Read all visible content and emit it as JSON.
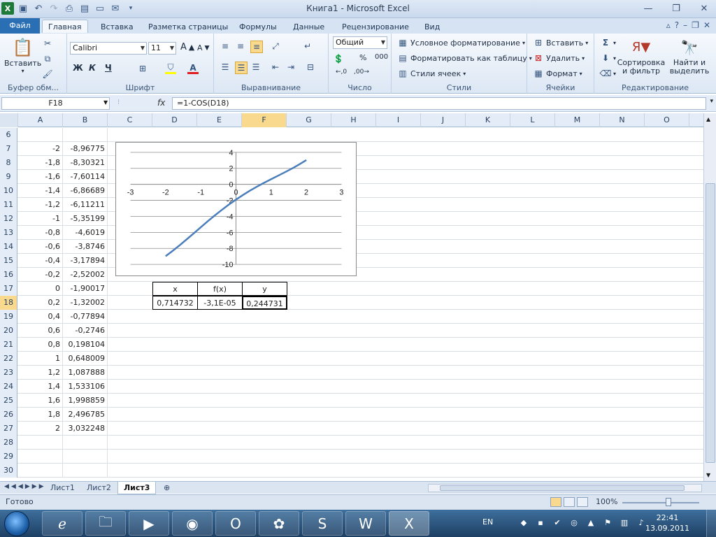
{
  "window": {
    "title": "Книга1  -  Microsoft Excel",
    "qat_icons": [
      "excel-logo-icon",
      "save-icon",
      "undo-icon",
      "redo-icon",
      "print-preview-icon",
      "quick-print-icon",
      "open-icon",
      "email-icon",
      "customize-icon"
    ]
  },
  "ribbon": {
    "file_tab": "Файл",
    "tabs": [
      "Главная",
      "Вставка",
      "Разметка страницы",
      "Формулы",
      "Данные",
      "Рецензирование",
      "Вид"
    ],
    "active_tab": "Главная",
    "groups": {
      "clipboard": {
        "label": "Буфер обм...",
        "paste": "Вставить"
      },
      "font": {
        "label": "Шрифт",
        "name": "Calibri",
        "size": "11",
        "bold": "Ж",
        "italic": "К",
        "underline": "Ч"
      },
      "alignment": {
        "label": "Выравнивание"
      },
      "number": {
        "label": "Число",
        "format": "Общий",
        "percent": "%",
        "thousands": "000"
      },
      "styles": {
        "label": "Стили",
        "conditional": "Условное форматирование",
        "as_table": "Форматировать как таблицу",
        "cell_styles": "Стили ячеек"
      },
      "cells": {
        "label": "Ячейки",
        "insert": "Вставить",
        "delete": "Удалить",
        "format": "Формат"
      },
      "editing": {
        "label": "Редактирование",
        "sort": "Сортировка и фильтр",
        "find": "Найти и выделить"
      }
    }
  },
  "formula_bar": {
    "name_box": "F18",
    "fx": "fx",
    "formula": "=1-COS(D18)"
  },
  "grid": {
    "columns": [
      "A",
      "B",
      "C",
      "D",
      "E",
      "F",
      "G",
      "H",
      "I",
      "J",
      "K",
      "L",
      "M",
      "N",
      "O"
    ],
    "selected_column": "F",
    "selected_row": "18",
    "rows": [
      {
        "n": "6",
        "a": "",
        "b": ""
      },
      {
        "n": "7",
        "a": "-2",
        "b": "-8,96775"
      },
      {
        "n": "8",
        "a": "-1,8",
        "b": "-8,30321"
      },
      {
        "n": "9",
        "a": "-1,6",
        "b": "-7,60114"
      },
      {
        "n": "10",
        "a": "-1,4",
        "b": "-6,86689"
      },
      {
        "n": "11",
        "a": "-1,2",
        "b": "-6,11211"
      },
      {
        "n": "12",
        "a": "-1",
        "b": "-5,35199"
      },
      {
        "n": "13",
        "a": "-0,8",
        "b": "-4,6019"
      },
      {
        "n": "14",
        "a": "-0,6",
        "b": "-3,8746"
      },
      {
        "n": "15",
        "a": "-0,4",
        "b": "-3,17894"
      },
      {
        "n": "16",
        "a": "-0,2",
        "b": "-2,52002"
      },
      {
        "n": "17",
        "a": "0",
        "b": "-1,90017"
      },
      {
        "n": "18",
        "a": "0,2",
        "b": "-1,32002"
      },
      {
        "n": "19",
        "a": "0,4",
        "b": "-0,77894"
      },
      {
        "n": "20",
        "a": "0,6",
        "b": "-0,2746"
      },
      {
        "n": "21",
        "a": "0,8",
        "b": "0,198104"
      },
      {
        "n": "22",
        "a": "1",
        "b": "0,648009"
      },
      {
        "n": "23",
        "a": "1,2",
        "b": "1,087888"
      },
      {
        "n": "24",
        "a": "1,4",
        "b": "1,533106"
      },
      {
        "n": "25",
        "a": "1,6",
        "b": "1,998859"
      },
      {
        "n": "26",
        "a": "1,8",
        "b": "2,496785"
      },
      {
        "n": "27",
        "a": "2",
        "b": "3,032248"
      },
      {
        "n": "28",
        "a": "",
        "b": ""
      },
      {
        "n": "29",
        "a": "",
        "b": ""
      },
      {
        "n": "30",
        "a": "",
        "b": ""
      }
    ],
    "table": {
      "headers": [
        "x",
        "f(x)",
        "y"
      ],
      "values": [
        "0,714732",
        "-3,1E-05",
        "0,244731"
      ]
    }
  },
  "chart_data": {
    "type": "scatter",
    "x_ticks": [
      "-3",
      "-2",
      "-1",
      "0",
      "1",
      "2",
      "3"
    ],
    "y_ticks": [
      "4",
      "2",
      "0",
      "-2",
      "-4",
      "-6",
      "-8",
      "-10"
    ],
    "xlim": [
      -3,
      3
    ],
    "ylim": [
      -10,
      4
    ],
    "grid": "horizontal",
    "line_color": "#4a7ebb",
    "series": [
      {
        "x": [
          -2,
          -1.8,
          -1.6,
          -1.4,
          -1.2,
          -1,
          -0.8,
          -0.6,
          -0.4,
          -0.2,
          0,
          0.2,
          0.4,
          0.6,
          0.8,
          1,
          1.2,
          1.4,
          1.6,
          1.8,
          2
        ],
        "y": [
          -8.96775,
          -8.30321,
          -7.60114,
          -6.86689,
          -6.11211,
          -5.35199,
          -4.6019,
          -3.8746,
          -3.17894,
          -2.52002,
          -1.90017,
          -1.32002,
          -0.77894,
          -0.2746,
          0.198104,
          0.648009,
          1.087888,
          1.533106,
          1.998859,
          2.496785,
          3.032248
        ]
      }
    ]
  },
  "sheets": {
    "tabs": [
      "Лист1",
      "Лист2",
      "Лист3"
    ],
    "active": "Лист3"
  },
  "status": {
    "text": "Готово",
    "zoom": "100%"
  },
  "taskbar": {
    "apps": [
      "ie-icon",
      "explorer-icon",
      "media-icon",
      "firefox-icon",
      "opera-icon",
      "app-icon",
      "skype-icon",
      "word-icon",
      "excel-icon"
    ],
    "lang": "EN",
    "time": "22:41",
    "date": "13.09.2011"
  }
}
